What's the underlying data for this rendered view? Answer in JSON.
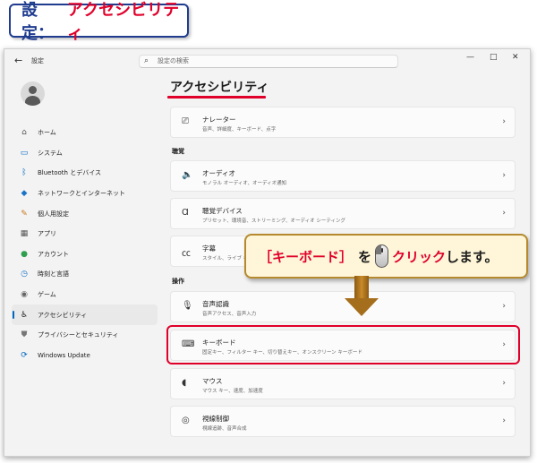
{
  "caption": {
    "part1": "設定：",
    "part2": "アクセシビリティ"
  },
  "titlebar": {
    "back": "←",
    "app_title": "設定",
    "search_placeholder": "設定の検索",
    "minimize": "—",
    "maximize": "□",
    "close": "✕"
  },
  "sidebar": {
    "items": [
      {
        "icon": "home-icon",
        "label": "ホーム",
        "glyph": "⌂",
        "color": "#555555"
      },
      {
        "icon": "system-icon",
        "label": "システム",
        "glyph": "▭",
        "color": "#0067c0"
      },
      {
        "icon": "bluetooth-icon",
        "label": "Bluetooth とデバイス",
        "glyph": "ᛒ",
        "color": "#0067c0"
      },
      {
        "icon": "network-icon",
        "label": "ネットワークとインターネット",
        "glyph": "◆",
        "color": "#1a73c7"
      },
      {
        "icon": "personalize-icon",
        "label": "個人用設定",
        "glyph": "✎",
        "color": "#c9781e"
      },
      {
        "icon": "apps-icon",
        "label": "アプリ",
        "glyph": "▦",
        "color": "#555555"
      },
      {
        "icon": "account-icon",
        "label": "アカウント",
        "glyph": "●",
        "color": "#2e9e4f"
      },
      {
        "icon": "time-language-icon",
        "label": "時刻と言語",
        "glyph": "◷",
        "color": "#1a73c7"
      },
      {
        "icon": "gaming-icon",
        "label": "ゲーム",
        "glyph": "◉",
        "color": "#666666"
      },
      {
        "icon": "accessibility-icon",
        "label": "アクセシビリティ",
        "glyph": "♿",
        "color": "#1b1b1b"
      },
      {
        "icon": "privacy-icon",
        "label": "プライバシーとセキュリティ",
        "glyph": "⛊",
        "color": "#777777"
      },
      {
        "icon": "windows-update-icon",
        "label": "Windows Update",
        "glyph": "⟳",
        "color": "#0067c0"
      }
    ],
    "active_index": 9
  },
  "main": {
    "title": "アクセシビリティ",
    "narrator": {
      "title": "ナレーター",
      "desc": "音声、詳細度、キーボード、点字",
      "icon": "narrator-icon",
      "glyph": "⎚"
    },
    "section_hearing": "聴覚",
    "audio": {
      "title": "オーディオ",
      "desc": "モノラル オーディオ、オーディオ通知",
      "icon": "speaker-icon",
      "glyph": "🔈"
    },
    "hearing_devices": {
      "title": "聴覚デバイス",
      "desc": "プリセット、環境音、ストリーミング、オーディオ シーティング",
      "icon": "hearing-icon",
      "glyph": "Ɑ"
    },
    "captions": {
      "title": "字幕",
      "desc": "スタイル、ライブ キ",
      "icon": "captions-icon",
      "glyph": "㏄"
    },
    "section_interaction": "操作",
    "speech": {
      "title": "音声認識",
      "desc": "音声アクセス、音声入力",
      "icon": "microphone-icon",
      "glyph": "🎙"
    },
    "keyboard": {
      "title": "キーボード",
      "desc": "固定キー、フィルター キー、切り替えキー、オンスクリーン キーボード",
      "icon": "keyboard-icon",
      "glyph": "⌨"
    },
    "mouse": {
      "title": "マウス",
      "desc": "マウス キー、速度、加速度",
      "icon": "mouse-icon",
      "glyph": "◖"
    },
    "eye_control": {
      "title": "視線制御",
      "desc": "視線追跡、音声合成",
      "icon": "eye-control-icon",
      "glyph": "◎"
    },
    "chevron": "›"
  },
  "callout": {
    "part1": "［キーボード］",
    "part2": "を",
    "part3": "クリック",
    "part4": "します。"
  },
  "colors": {
    "accent": "#0067c0",
    "highlight": "#e0002a",
    "callout_border": "#b58a2e"
  }
}
